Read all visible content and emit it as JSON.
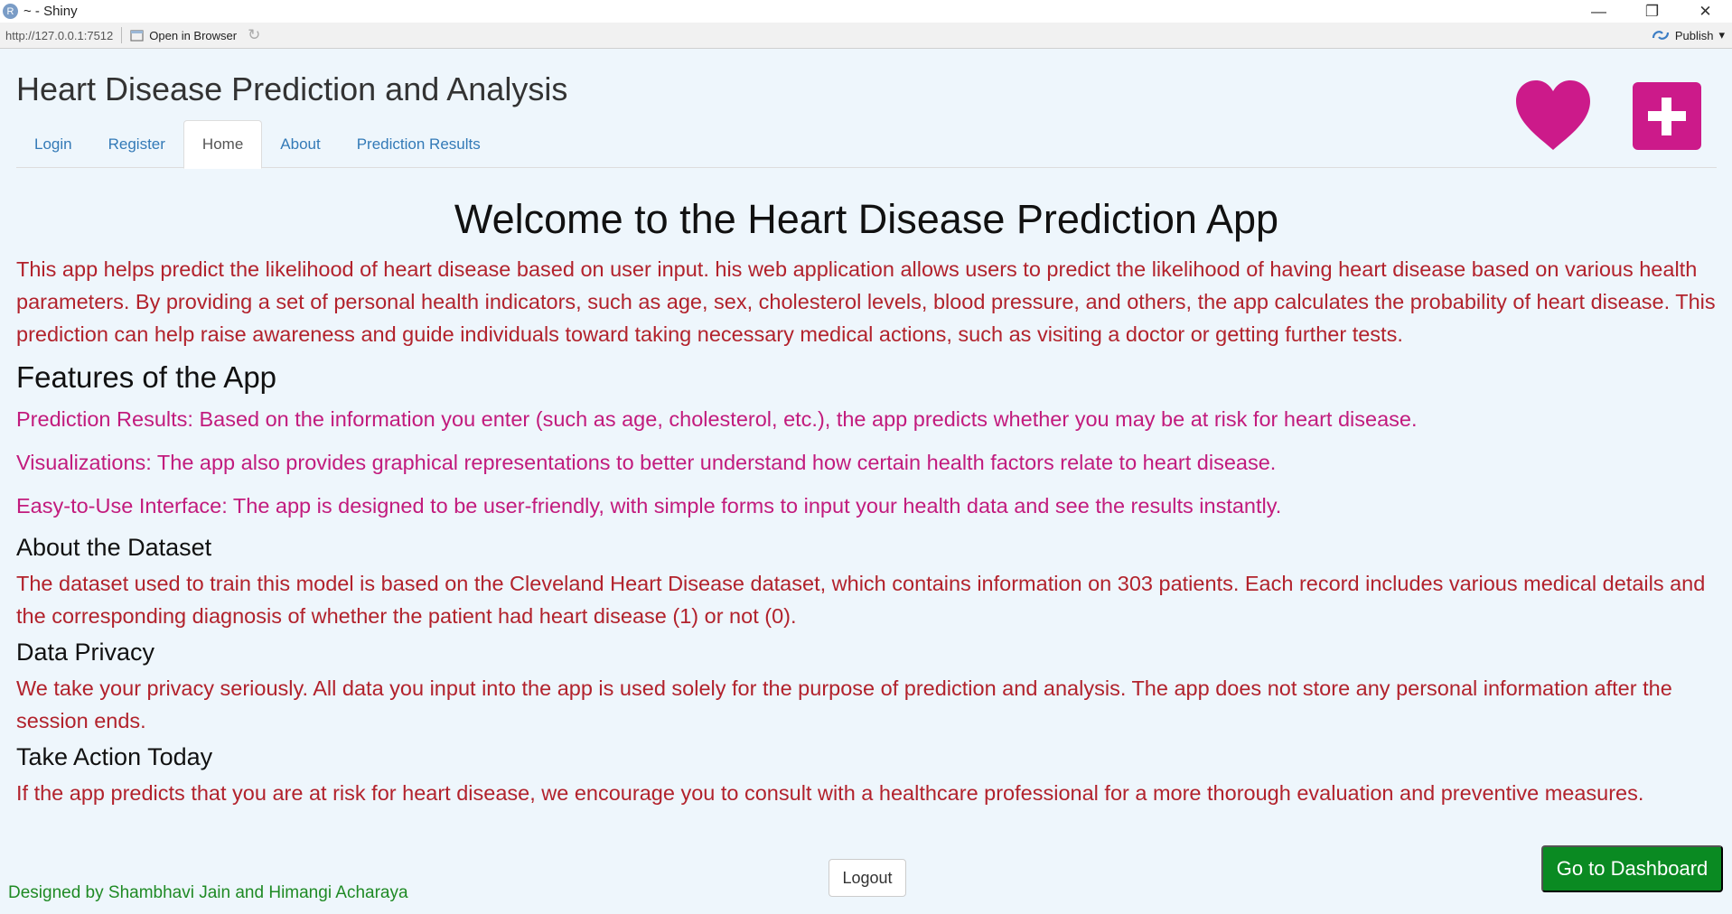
{
  "window": {
    "app_icon_letter": "R",
    "title": "~ - Shiny",
    "minimize_glyph": "—",
    "restore_glyph": "❐",
    "close_glyph": "✕"
  },
  "addressbar": {
    "url": "http://127.0.0.1:7512",
    "open_in_browser": "Open in Browser",
    "refresh_glyph": "↻",
    "publish": "Publish",
    "publish_dropdown_glyph": "▾"
  },
  "header": {
    "title": "Heart Disease Prediction and Analysis",
    "logo_colors": {
      "accent": "#cc1a8a"
    }
  },
  "nav": {
    "tabs": [
      {
        "label": "Login",
        "active": false
      },
      {
        "label": "Register",
        "active": false
      },
      {
        "label": "Home",
        "active": true
      },
      {
        "label": "About",
        "active": false
      },
      {
        "label": "Prediction Results",
        "active": false
      }
    ]
  },
  "main": {
    "welcome": "Welcome to the Heart Disease Prediction App",
    "intro": "This app helps predict the likelihood of heart disease based on user input. his web application allows users to predict the likelihood of having heart disease based on various health parameters. By providing a set of personal health indicators, such as age, sex, cholesterol levels, blood pressure, and others, the app calculates the probability of heart disease. This prediction can help raise awareness and guide individuals toward taking necessary medical actions, such as visiting a doctor or getting further tests.",
    "features_heading": "Features of the App",
    "features": [
      "Prediction Results: Based on the information you enter (such as age, cholesterol, etc.), the app predicts whether you may be at risk for heart disease.",
      "Visualizations: The app also provides graphical representations to better understand how certain health factors relate to heart disease.",
      "Easy-to-Use Interface: The app is designed to be user-friendly, with simple forms to input your health data and see the results instantly."
    ],
    "dataset_heading": "About the Dataset",
    "dataset_text": "The dataset used to train this model is based on the Cleveland Heart Disease dataset, which contains information on 303 patients. Each record includes various medical details and the corresponding diagnosis of whether the patient had heart disease (1) or not (0).",
    "privacy_heading": "Data Privacy",
    "privacy_text": "We take your privacy seriously. All data you input into the app is used solely for the purpose of prediction and analysis. The app does not store any personal information after the session ends.",
    "action_heading": "Take Action Today",
    "action_text": "If the app predicts that you are at risk for heart disease, we encourage you to consult with a healthcare professional for a more thorough evaluation and preventive measures."
  },
  "footer": {
    "logout": "Logout",
    "credit": "Designed by Shambhavi Jain and Himangi Acharaya",
    "dashboard": "Go to Dashboard"
  },
  "colors": {
    "red_text": "#b2222c",
    "pink_text": "#c21b7d",
    "green": "#0a8a22",
    "link": "#337ab7"
  }
}
